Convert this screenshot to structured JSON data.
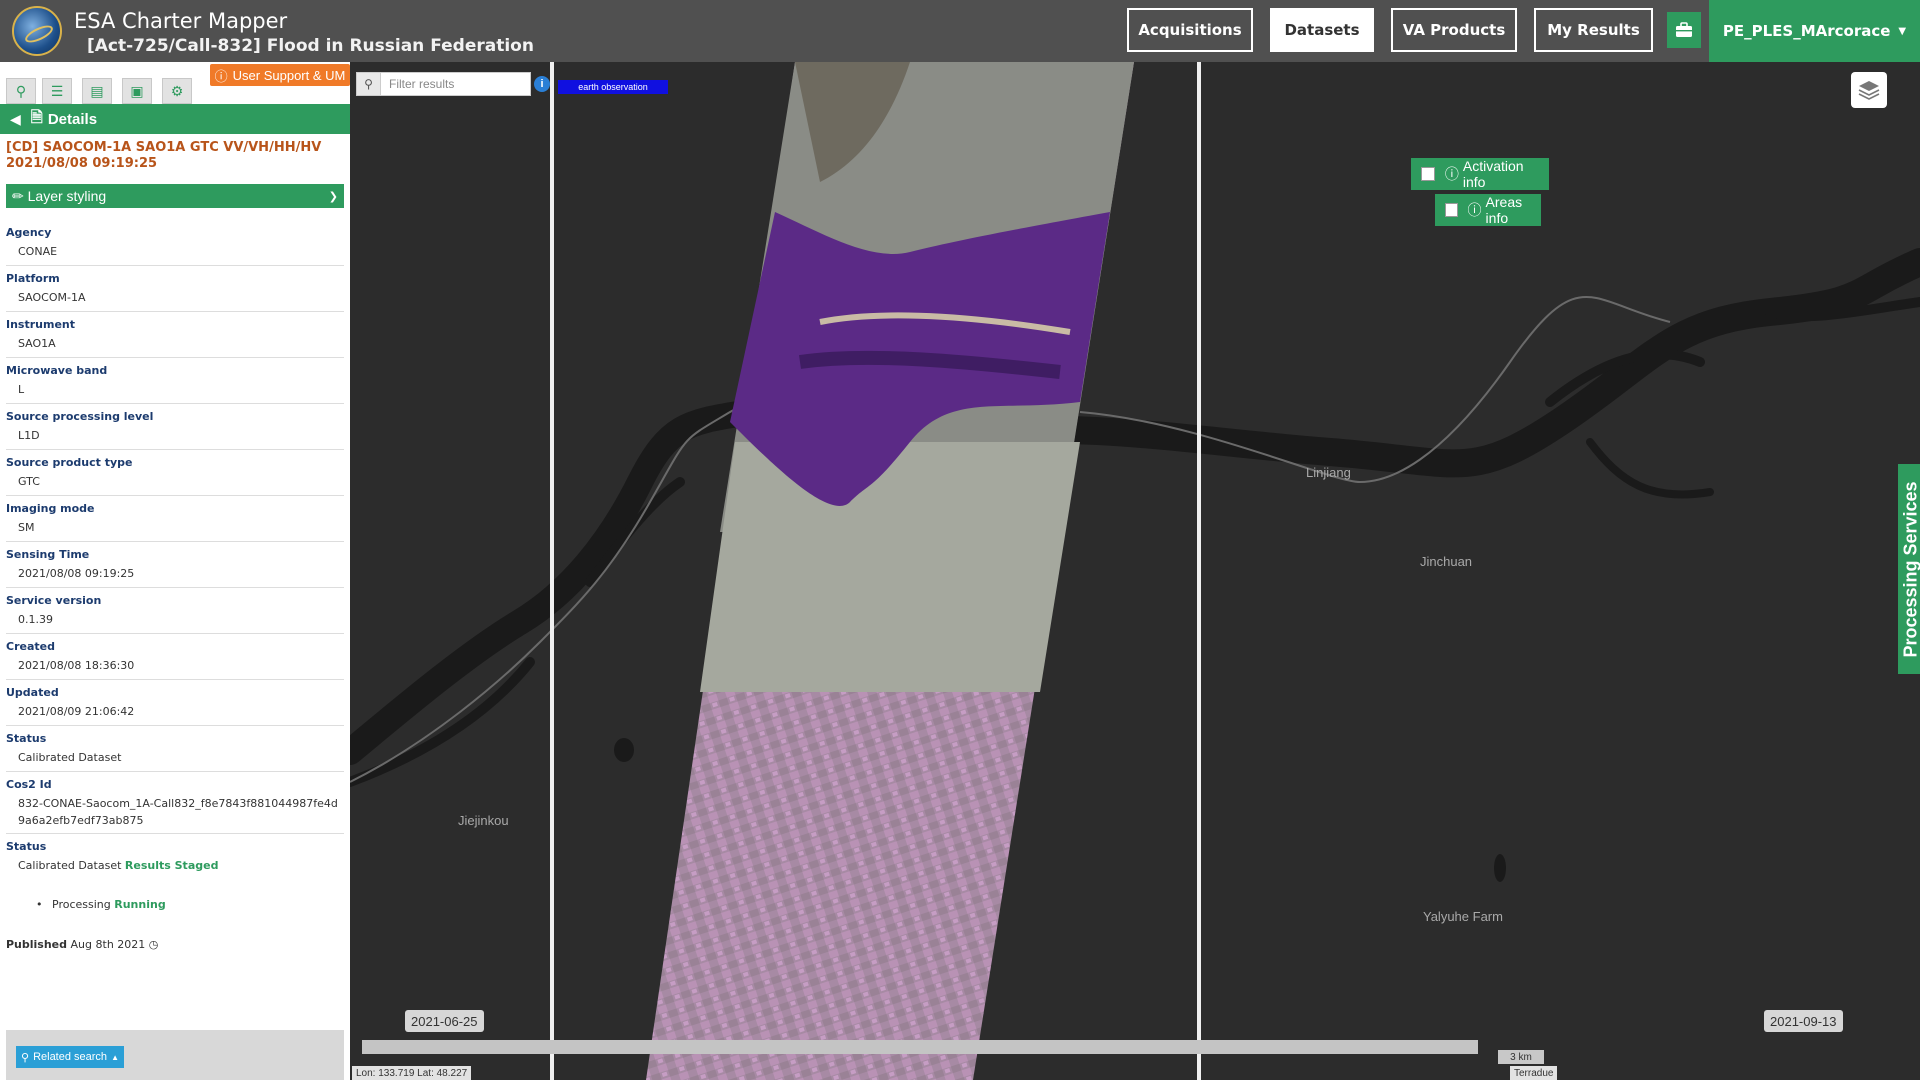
{
  "header": {
    "app_title": "ESA Charter Mapper",
    "subtitle": "[Act-725/Call-832] Flood in Russian Federation",
    "nav": [
      "Acquisitions",
      "Datasets",
      "VA Products",
      "My Results"
    ],
    "active_nav": "Datasets",
    "user": "PE_PLES_MArcorace"
  },
  "panel": {
    "support_label": "User Support & UM",
    "details_label": "Details",
    "product_title": "[CD] SAOCOM-1A SAO1A GTC VV/VH/HH/HV 2021/08/08 09:19:25",
    "layer_styling_label": "Layer styling",
    "fields": [
      {
        "key": "Agency",
        "value": "CONAE"
      },
      {
        "key": "Platform",
        "value": "SAOCOM-1A"
      },
      {
        "key": "Instrument",
        "value": "SAO1A"
      },
      {
        "key": "Microwave band",
        "value": "L"
      },
      {
        "key": "Source processing level",
        "value": "L1D"
      },
      {
        "key": "Source product type",
        "value": "GTC"
      },
      {
        "key": "Imaging mode",
        "value": "SM"
      },
      {
        "key": "Sensing Time",
        "value": "2021/08/08 09:19:25"
      },
      {
        "key": "Service version",
        "value": "0.1.39"
      },
      {
        "key": "Created",
        "value": "2021/08/08 18:36:30"
      },
      {
        "key": "Updated",
        "value": "2021/08/09 21:06:42"
      },
      {
        "key": "Status",
        "value": "Calibrated Dataset"
      },
      {
        "key": "Cos2 Id",
        "value": "832-CONAE-Saocom_1A-Call832_f8e7843f881044987fe4d9a6a2efb7edf73ab875"
      }
    ],
    "status2_key": "Status",
    "status2_value": "Calibrated Dataset",
    "status2_extra": "Results Staged",
    "processing_label": "Processing",
    "processing_state": "Running",
    "published_label": "Published",
    "published_date": "Aug 8th 2021",
    "related_search_label": "Related search"
  },
  "map": {
    "filter_placeholder": "Filter results",
    "eo_tag": "earth observation",
    "activation_info": "Activation info",
    "areas_info": "Areas info",
    "processing_services": "Processing Services",
    "places": [
      "Linjiang",
      "Jinchuan",
      "Jiejinkou",
      "Yalyuhe Farm"
    ],
    "timeline_start": "2021-06-25",
    "timeline_end": "2021-09-13",
    "scale": "3 km",
    "coords": "Lon: 133.719 Lat: 48.227",
    "attribution": "Terradue"
  },
  "colors": {
    "header_bg": "#505050",
    "accent_green": "#2e9b5e",
    "support_orange": "#f07a28",
    "title_brown": "#b8541a",
    "field_key_blue": "#1c3b6e",
    "map_bg": "#2c2c2c",
    "river_color": "#1a1a1a",
    "flood_purple": "#5b2a86"
  }
}
